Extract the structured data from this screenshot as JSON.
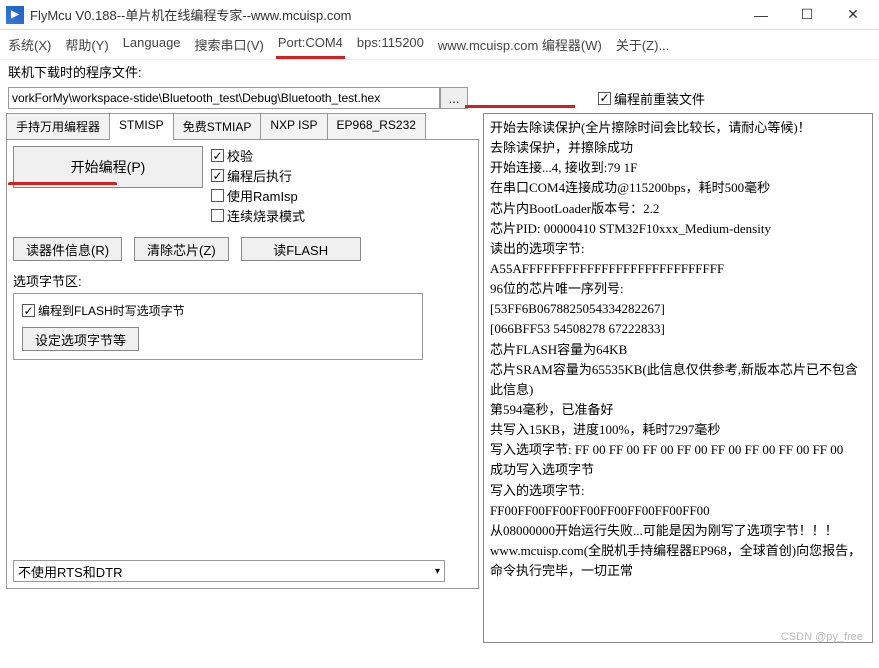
{
  "titlebar": {
    "logo_text": "▶",
    "title": "FlyMcu V0.188--单片机在线编程专家--www.mcuisp.com"
  },
  "menu": {
    "system": "系统(X)",
    "help": "帮助(Y)",
    "language": "Language",
    "search_port": "搜索串口(V)",
    "port": "Port:COM4",
    "bps": "bps:115200",
    "site": "www.mcuisp.com 编程器(W)",
    "about": "关于(Z)..."
  },
  "file": {
    "label": "联机下载时的程序文件:",
    "path": "vorkForMy\\workspace-stide\\Bluetooth_test\\Debug\\Bluetooth_test.hex",
    "browse": "...",
    "reinstall": "编程前重装文件"
  },
  "tabs": {
    "t1": "手持万用编程器",
    "t2": "STMISP",
    "t3": "免费STMIAP",
    "t4": "NXP ISP",
    "t5": "EP968_RS232"
  },
  "prog": {
    "start": "开始编程(P)",
    "checks": {
      "verify": "校验",
      "run_after": "编程后执行",
      "use_ramisp": "使用RamIsp",
      "continuous": "连续烧录模式"
    },
    "btn_readinfo": "读器件信息(R)",
    "btn_erase": "清除芯片(Z)",
    "btn_readflash": "读FLASH"
  },
  "opt": {
    "label": "选项字节区:",
    "write_opt": "编程到FLASH时写选项字节",
    "set_btn": "设定选项字节等"
  },
  "dtr": {
    "value": "不使用RTS和DTR"
  },
  "log": {
    "l1": "开始去除读保护(全片擦除时间会比较长，请耐心等候)！",
    "l2": "去除读保护，并擦除成功",
    "l3": "开始连接...4, 接收到:79 1F",
    "l4": "在串口COM4连接成功@115200bps，耗时500毫秒",
    "l5": "芯片内BootLoader版本号：2.2",
    "l6": "芯片PID: 00000410  STM32F10xxx_Medium-density",
    "l7": "读出的选项字节:",
    "l8": "A55AFFFFFFFFFFFFFFFFFFFFFFFFFFFF",
    "l9": "96位的芯片唯一序列号:",
    "l10": "[53FF6B0678825054334282267]",
    "l11": "[066BFF53 54508278 67222833]",
    "l12": "芯片FLASH容量为64KB",
    "l13": "芯片SRAM容量为65535KB(此信息仅供参考,新版本芯片已不包含此信息)",
    "l14": "第594毫秒，已准备好",
    "l15": "共写入15KB，进度100%，耗时7297毫秒",
    "l16": "写入选项字节: FF 00 FF 00 FF 00 FF 00 FF 00 FF 00 FF 00 FF 00",
    "l17": "成功写入选项字节",
    "l18": "写入的选项字节:",
    "l19": "FF00FF00FF00FF00FF00FF00FF00FF00",
    "l20": "从08000000开始运行失败...可能是因为刚写了选项字节！！！",
    "l21": "www.mcuisp.com(全脱机手持编程器EP968，全球首创)向您报告，命令执行完毕，一切正常"
  },
  "watermark": "CSDN @py_free"
}
